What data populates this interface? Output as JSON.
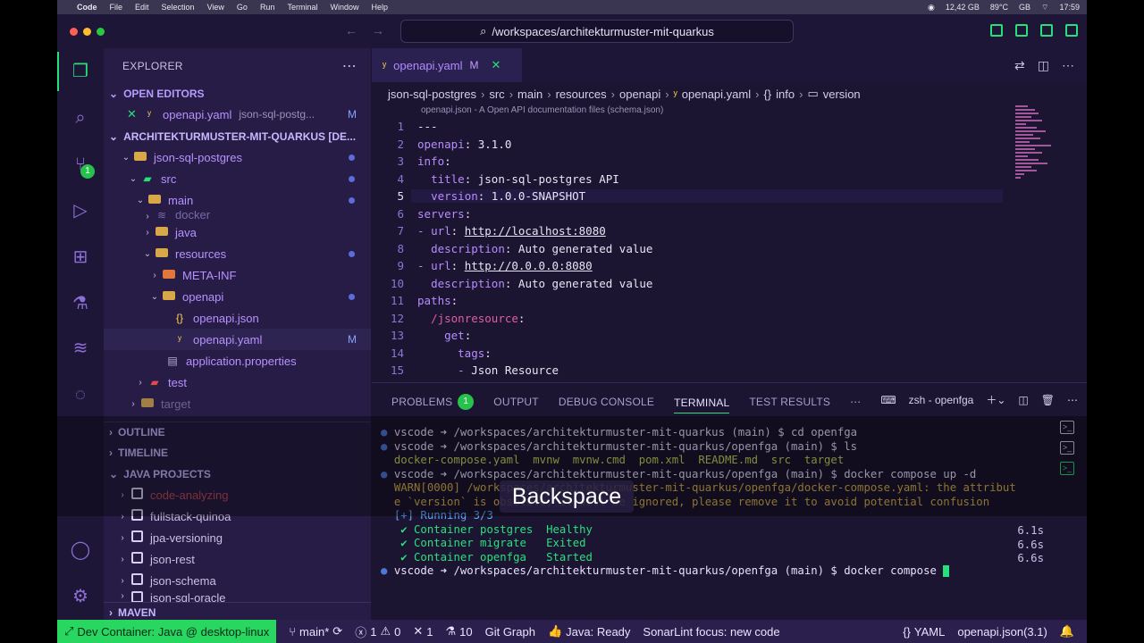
{
  "menubar": {
    "app": "Code",
    "menus": [
      "File",
      "Edit",
      "Selection",
      "View",
      "Go",
      "Run",
      "Terminal",
      "Window",
      "Help"
    ],
    "memory": "12,42 GB",
    "temp": "89°C",
    "country": "GB",
    "clock": "17:59"
  },
  "titlebar": {
    "command_center": "/workspaces/architekturmuster-mit-quarkus"
  },
  "activity": {
    "scm_badge": "1"
  },
  "sidebar": {
    "title": "EXPLORER",
    "open_editors_title": "OPEN EDITORS",
    "open_editor": {
      "name": "openapi.yaml",
      "path": "json-sql-postg...",
      "flag": "M"
    },
    "workspace_title": "ARCHITEKTURMUSTER-MIT-QUARKUS [DE...",
    "tree": [
      {
        "label": "json-sql-postgres"
      },
      {
        "label": "src"
      },
      {
        "label": "main"
      },
      {
        "label": "docker"
      },
      {
        "label": "java"
      },
      {
        "label": "resources"
      },
      {
        "label": "META-INF"
      },
      {
        "label": "openapi"
      },
      {
        "label": "openapi.json"
      },
      {
        "label": "openapi.yaml",
        "flag": "M"
      },
      {
        "label": "application.properties"
      },
      {
        "label": "test"
      },
      {
        "label": "target"
      }
    ],
    "outline": "OUTLINE",
    "timeline": "TIMELINE",
    "java_projects": "JAVA PROJECTS",
    "projects": [
      "code-analyzing",
      "fullstack-quinoa",
      "jpa-versioning",
      "json-rest",
      "json-schema",
      "json-sql-oracle"
    ],
    "maven": "MAVEN"
  },
  "editor": {
    "tab": {
      "name": "openapi.yaml",
      "flag": "M"
    },
    "breadcrumb": [
      "json-sql-postgres",
      "src",
      "main",
      "resources",
      "openapi",
      "openapi.yaml",
      "info",
      "version"
    ],
    "schema_hint": "openapi.json - A Open API documentation files (schema.json)",
    "lines": [
      {
        "n": "1",
        "text": "---"
      },
      {
        "n": "2",
        "text": "openapi: 3.1.0"
      },
      {
        "n": "3",
        "text": "info:"
      },
      {
        "n": "4",
        "text": "  title: json-sql-postgres API"
      },
      {
        "n": "5",
        "text": "  version: 1.0.0-SNAPSHOT"
      },
      {
        "n": "6",
        "text": "servers:"
      },
      {
        "n": "7",
        "text": "- url: http://localhost:8080"
      },
      {
        "n": "8",
        "text": "  description: Auto generated value"
      },
      {
        "n": "9",
        "text": "- url: http://0.0.0.0:8080"
      },
      {
        "n": "10",
        "text": "  description: Auto generated value"
      },
      {
        "n": "11",
        "text": "paths:"
      },
      {
        "n": "12",
        "text": "  /jsonresource:"
      },
      {
        "n": "13",
        "text": "    get:"
      },
      {
        "n": "14",
        "text": "      tags:"
      },
      {
        "n": "15",
        "text": "      - Json Resource"
      }
    ]
  },
  "panel": {
    "tabs": [
      "PROBLEMS",
      "OUTPUT",
      "DEBUG CONSOLE",
      "TERMINAL",
      "TEST RESULTS"
    ],
    "problems_count": "1",
    "terminal_name": "zsh - openfga",
    "terminal_lines": [
      "vscode ➜ /workspaces/architekturmuster-mit-quarkus (main) $ cd openfga",
      "vscode ➜ /workspaces/architekturmuster-mit-quarkus/openfga (main) $ ls",
      "docker-compose.yaml  mvnw  mvnw.cmd  pom.xml  README.md  src  target",
      "vscode ➜ /workspaces/architekturmuster-mit-quarkus/openfga (main) $ docker compose up -d",
      "WARN[0000] /workspaces/architekturmuster-mit-quarkus/openfga/docker-compose.yaml: the attribut",
      "e `version` is obsolete, it will be ignored, please remove it to avoid potential confusion",
      "[+] Running 3/3",
      " ✔ Container postgres  Healthy",
      " ✔ Container migrate   Exited",
      " ✔ Container openfga   Started",
      "vscode ➜ /workspaces/architekturmuster-mit-quarkus/openfga (main) $ docker compose "
    ],
    "times": [
      "6.1s",
      "6.6s",
      "6.6s"
    ],
    "key_overlay": "Backspace"
  },
  "statusbar": {
    "remote": "Dev Container: Java @ desktop-linux",
    "branch": "main*",
    "errors": "1",
    "warnings": "0",
    "ports": "1",
    "tests": "10",
    "git_graph": "Git Graph",
    "java": "Java: Ready",
    "sonarlint": "SonarLint focus: new code",
    "language": "YAML",
    "schema": "openapi.json(3.1)"
  },
  "colors": {
    "accent": "#27e07a",
    "background": "#1b1531",
    "sidebar": "#261c45"
  }
}
